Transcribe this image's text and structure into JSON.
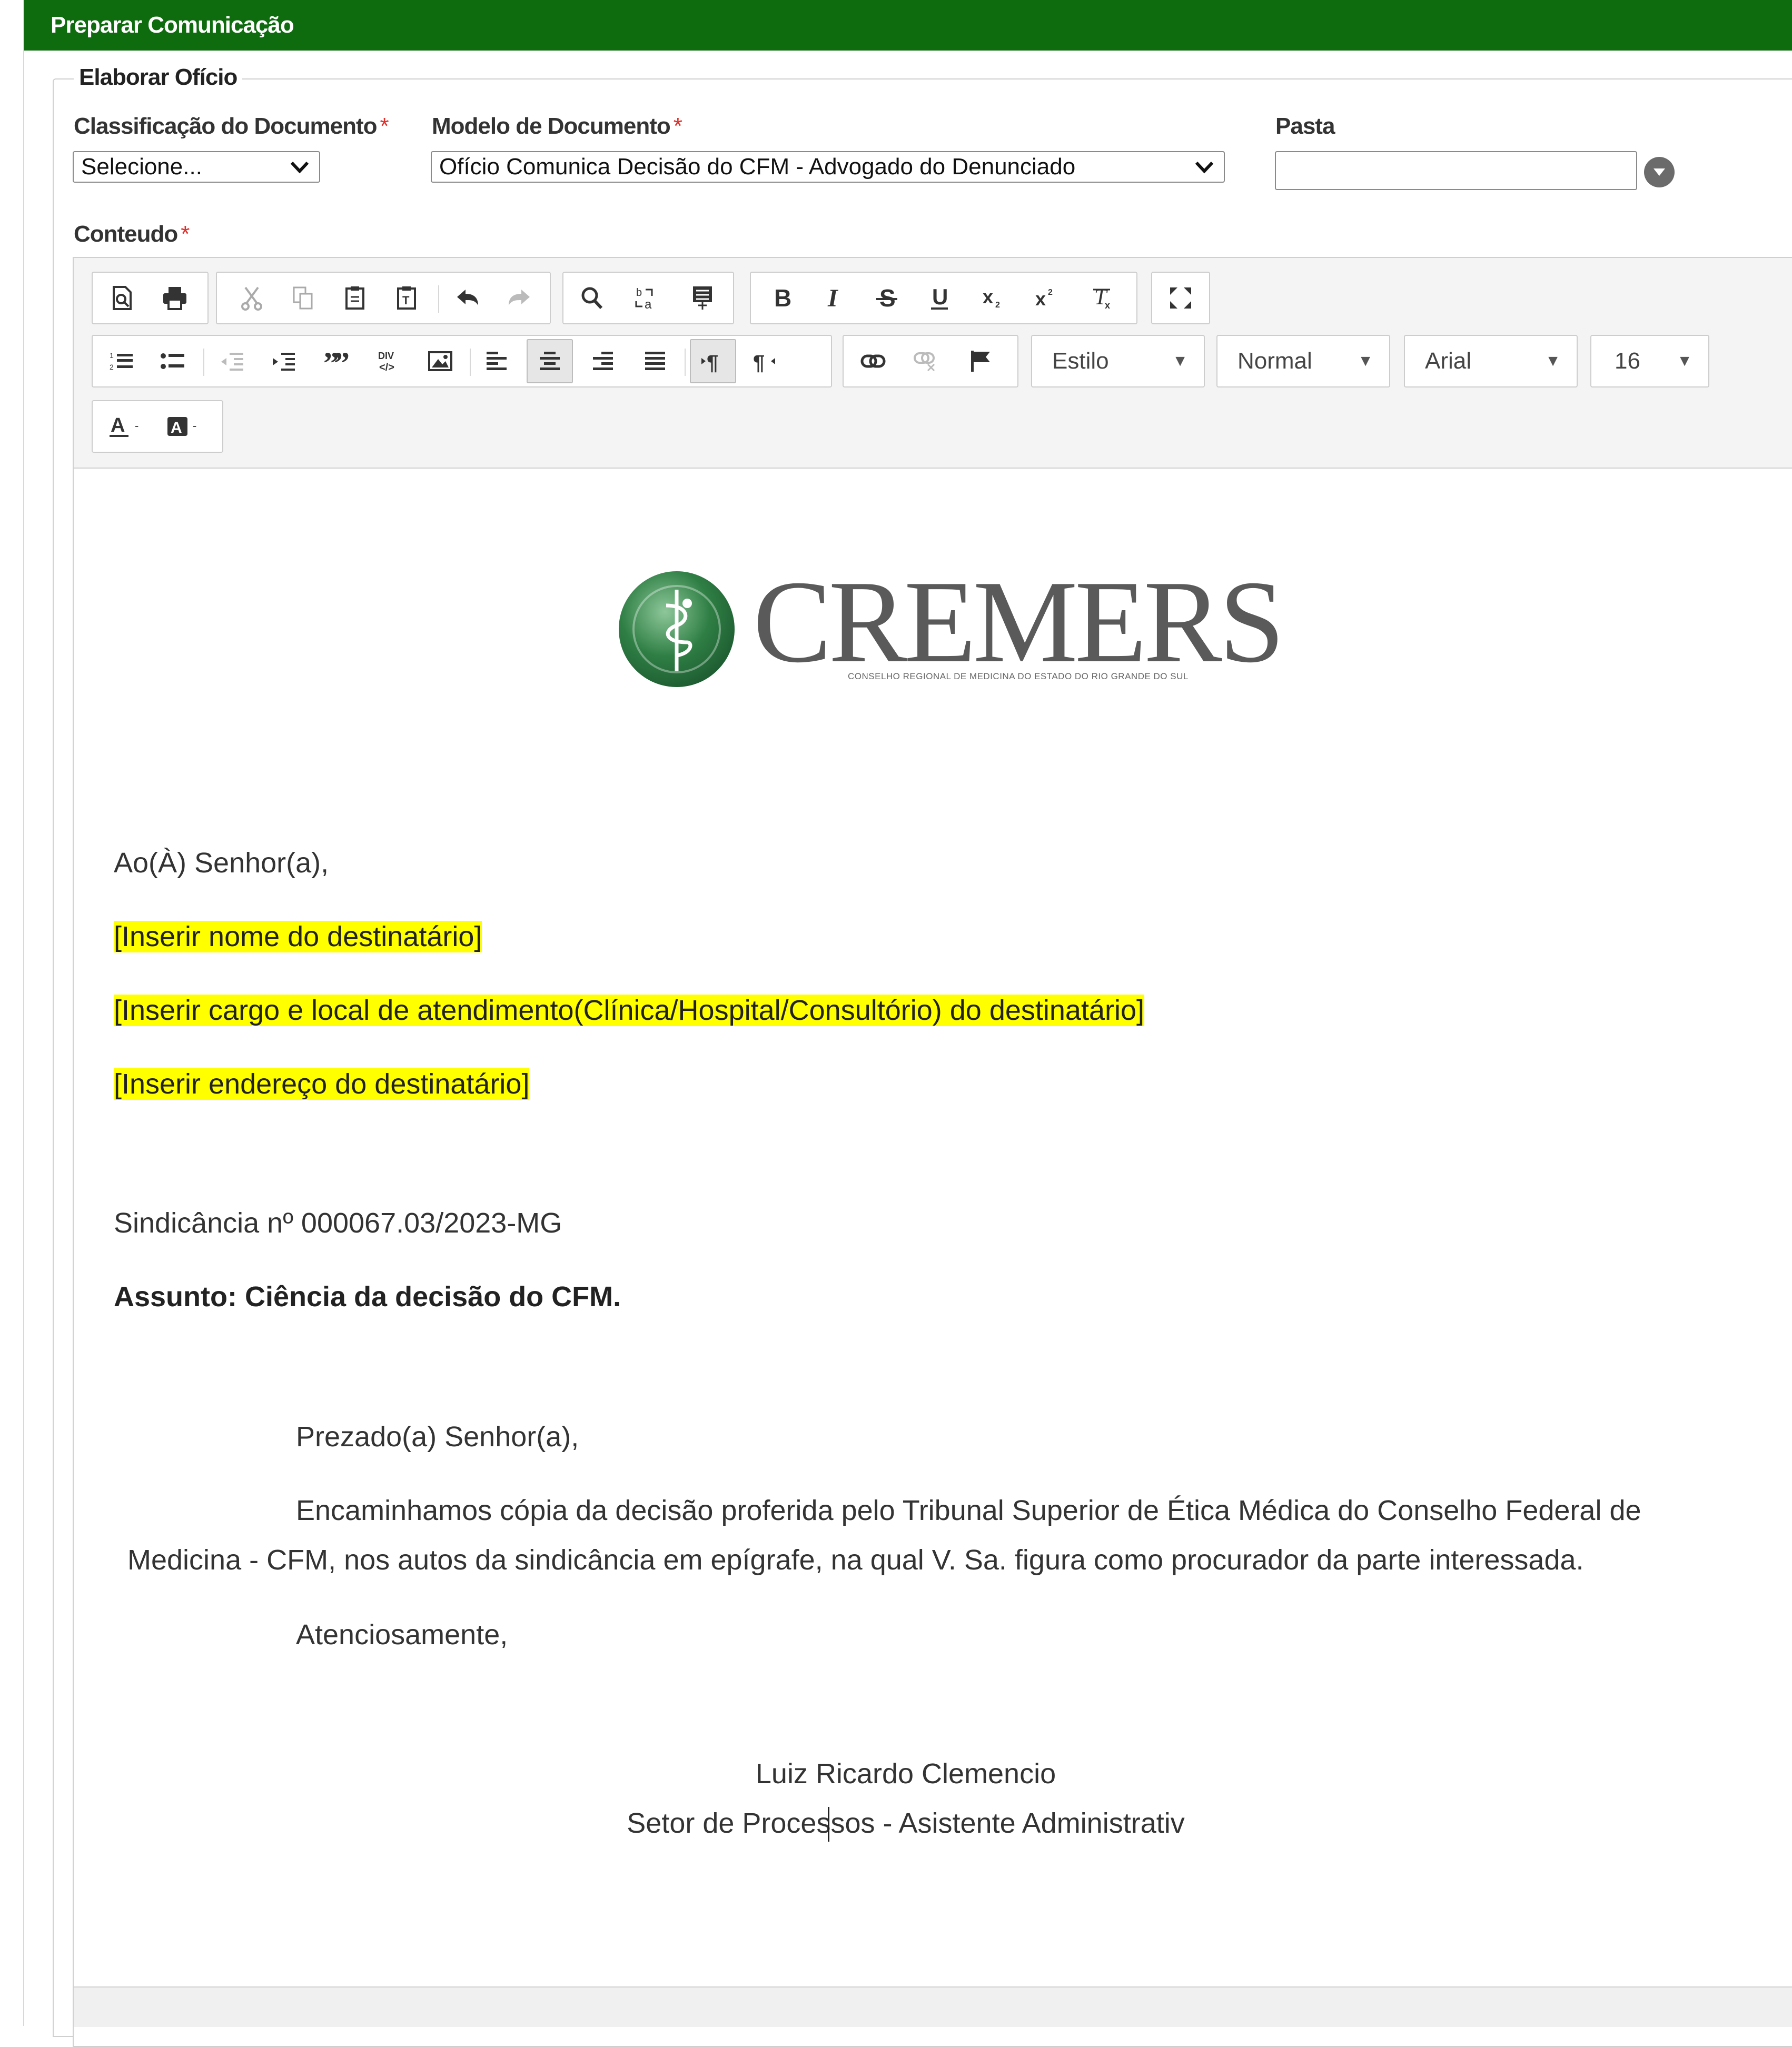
{
  "header": {
    "title": "Preparar Comunicação"
  },
  "fieldset": {
    "legend": "Elaborar Ofício"
  },
  "form": {
    "classificacao": {
      "label": "Classificação do Documento",
      "value": "Selecione..."
    },
    "modelo": {
      "label": "Modelo de Documento",
      "value": "Ofício Comunica Decisão do CFM - Advogado do Denunciado"
    },
    "pasta": {
      "label": "Pasta",
      "value": ""
    },
    "conteudo": {
      "label": "Conteudo"
    },
    "required_mark": "*"
  },
  "toolbar": {
    "row1": [
      "preview-icon",
      "print-icon",
      "cut-icon",
      "copy-icon",
      "paste-icon",
      "paste-text-icon",
      "undo-icon",
      "redo-icon",
      "find-icon",
      "replace-icon",
      "select-all-icon",
      "bold-icon",
      "italic-icon",
      "strikethrough-icon",
      "underline-icon",
      "subscript-icon",
      "superscript-icon",
      "remove-format-icon",
      "maximize-icon"
    ],
    "row2": [
      "numbered-list-icon",
      "bulleted-list-icon",
      "outdent-icon",
      "indent-icon",
      "blockquote-icon",
      "create-div-icon",
      "image-icon",
      "align-left-icon",
      "align-center-icon",
      "align-right-icon",
      "justify-icon",
      "ltr-icon",
      "rtl-icon",
      "link-icon",
      "unlink-icon",
      "anchor-icon"
    ],
    "style_combo": "Estilo",
    "format_combo": "Normal",
    "font_combo": "Arial",
    "size_combo": "16",
    "active_buttons": [
      "align-center-icon",
      "ltr-icon"
    ]
  },
  "document": {
    "logo": {
      "name": "CREMERS",
      "tagline": "CONSELHO REGIONAL DE MEDICINA DO ESTADO DO RIO GRANDE DO SUL"
    },
    "salutation": "Ao(À) Senhor(a),",
    "placeholder_name": "[Inserir nome do destinatário]",
    "placeholder_role": "[Inserir cargo e local de atendimento(Clínica/Hospital/Consultório) do destinatário]",
    "placeholder_address": "[Inserir endereço do destinatário]",
    "reference": "Sindicância nº 000067.03/2023-MG",
    "subject": "Assunto: Ciência da decisão do CFM.",
    "greeting": "Prezado(a) Senhor(a),",
    "body_line1": "Encaminhamos cópia da decisão proferida pelo Tribunal Superior de Ética Médica do Conselho Federal de",
    "body_line2": "Medicina - CFM, nos autos da sindicância em epígrafe, na qual V. Sa. figura como procurador da parte interessada.",
    "closing": "Atenciosamente,",
    "signer_name": "Luiz Ricardo Clemencio",
    "signer_role": "Setor de Processos - Asistente Administrativ"
  },
  "colors": {
    "header_bg": "#0e6b0e",
    "highlight": "#ffff00",
    "required": "#e0302b",
    "logo_green": "#2e7d3e",
    "logo_gray": "#5a5a5a"
  }
}
